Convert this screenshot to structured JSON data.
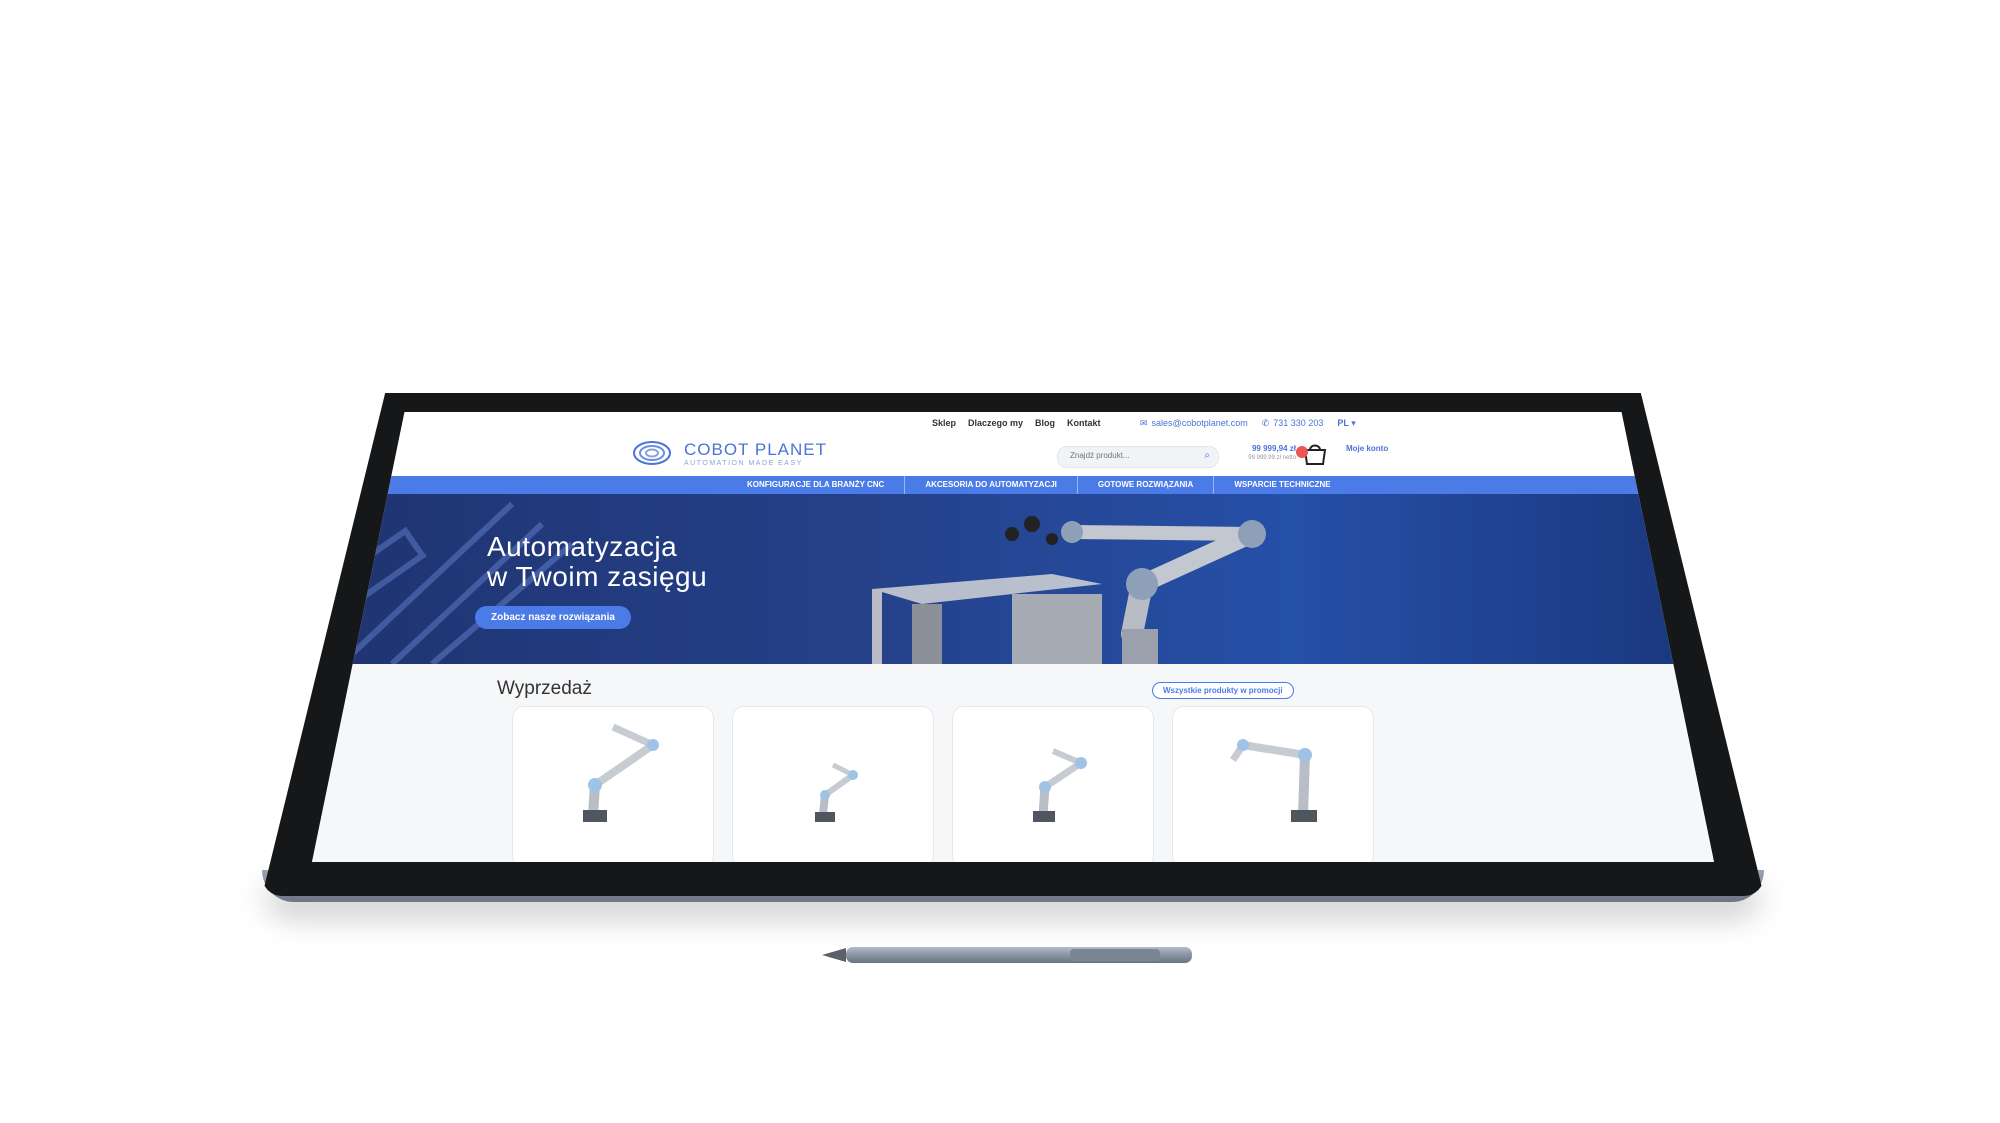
{
  "utility": {
    "links": [
      "Sklep",
      "Dlaczego my",
      "Blog",
      "Kontakt"
    ],
    "email": "sales@cobotplanet.com",
    "phone": "731 330 203",
    "language": "PL"
  },
  "header": {
    "logo_title": "COBOT PLANET",
    "logo_subtitle": "AUTOMATION MADE EASY",
    "search_placeholder": "Znajdź produkt...",
    "cart_gross": "99 999,94 zł",
    "cart_net": "99 999,99 zł netto",
    "account": "Moje konto"
  },
  "mainnav": {
    "items": [
      "KONFIGURACJE DLA BRANŻY CNC",
      "AKCESORIA DO AUTOMATYZACJI",
      "GOTOWE ROZWIĄZANIA",
      "WSPARCIE TECHNICZNE"
    ]
  },
  "hero": {
    "title_line1": "Automatyzacja",
    "title_line2": "w Twoim zasięgu",
    "cta": "Zobacz nasze rozwiązania"
  },
  "sale": {
    "title": "Wyprzedaż",
    "all_button": "Wszystkie produkty w promocji"
  },
  "colors": {
    "brand_blue": "#4b7be6",
    "hero_dark": "#1f3470",
    "device_bezel": "#151719"
  },
  "icons": [
    "mail-icon",
    "phone-icon",
    "search-icon",
    "cart-icon",
    "chevron-left-icon",
    "chevron-right-icon",
    "logo-swirl-icon"
  ]
}
